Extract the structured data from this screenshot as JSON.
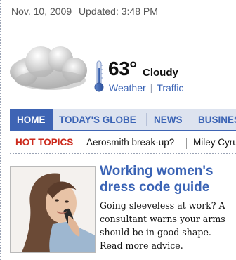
{
  "header": {
    "date": "Nov. 10, 2009",
    "updated": "Updated: 3:48 PM"
  },
  "weather": {
    "temperature": "63°",
    "condition": "Cloudy",
    "links": [
      {
        "label": "Weather"
      },
      {
        "label": "Traffic"
      }
    ],
    "icon": "cloud-icon",
    "thermometer_icon": "thermometer-icon"
  },
  "nav": {
    "items": [
      {
        "label": "HOME",
        "active": true
      },
      {
        "label": "TODAY'S GLOBE",
        "active": false
      },
      {
        "label": "NEWS",
        "active": false
      },
      {
        "label": "BUSINES",
        "active": false
      }
    ]
  },
  "hot_topics": {
    "label": "HOT TOPICS",
    "items": [
      "Aerosmith break-up?",
      "Miley Cyru"
    ]
  },
  "story": {
    "title": "Working women's dress code guide",
    "body": "Going sleeveless at work? A consultant warns your arms should be in good shape. Read more advice.",
    "photo": "woman-on-phone-photo"
  },
  "colors": {
    "link_blue": "#3a63b5",
    "nav_active": "#3e64b4",
    "nav_bg": "#dde3ef",
    "hot_topics_red": "#cc2b1e"
  }
}
